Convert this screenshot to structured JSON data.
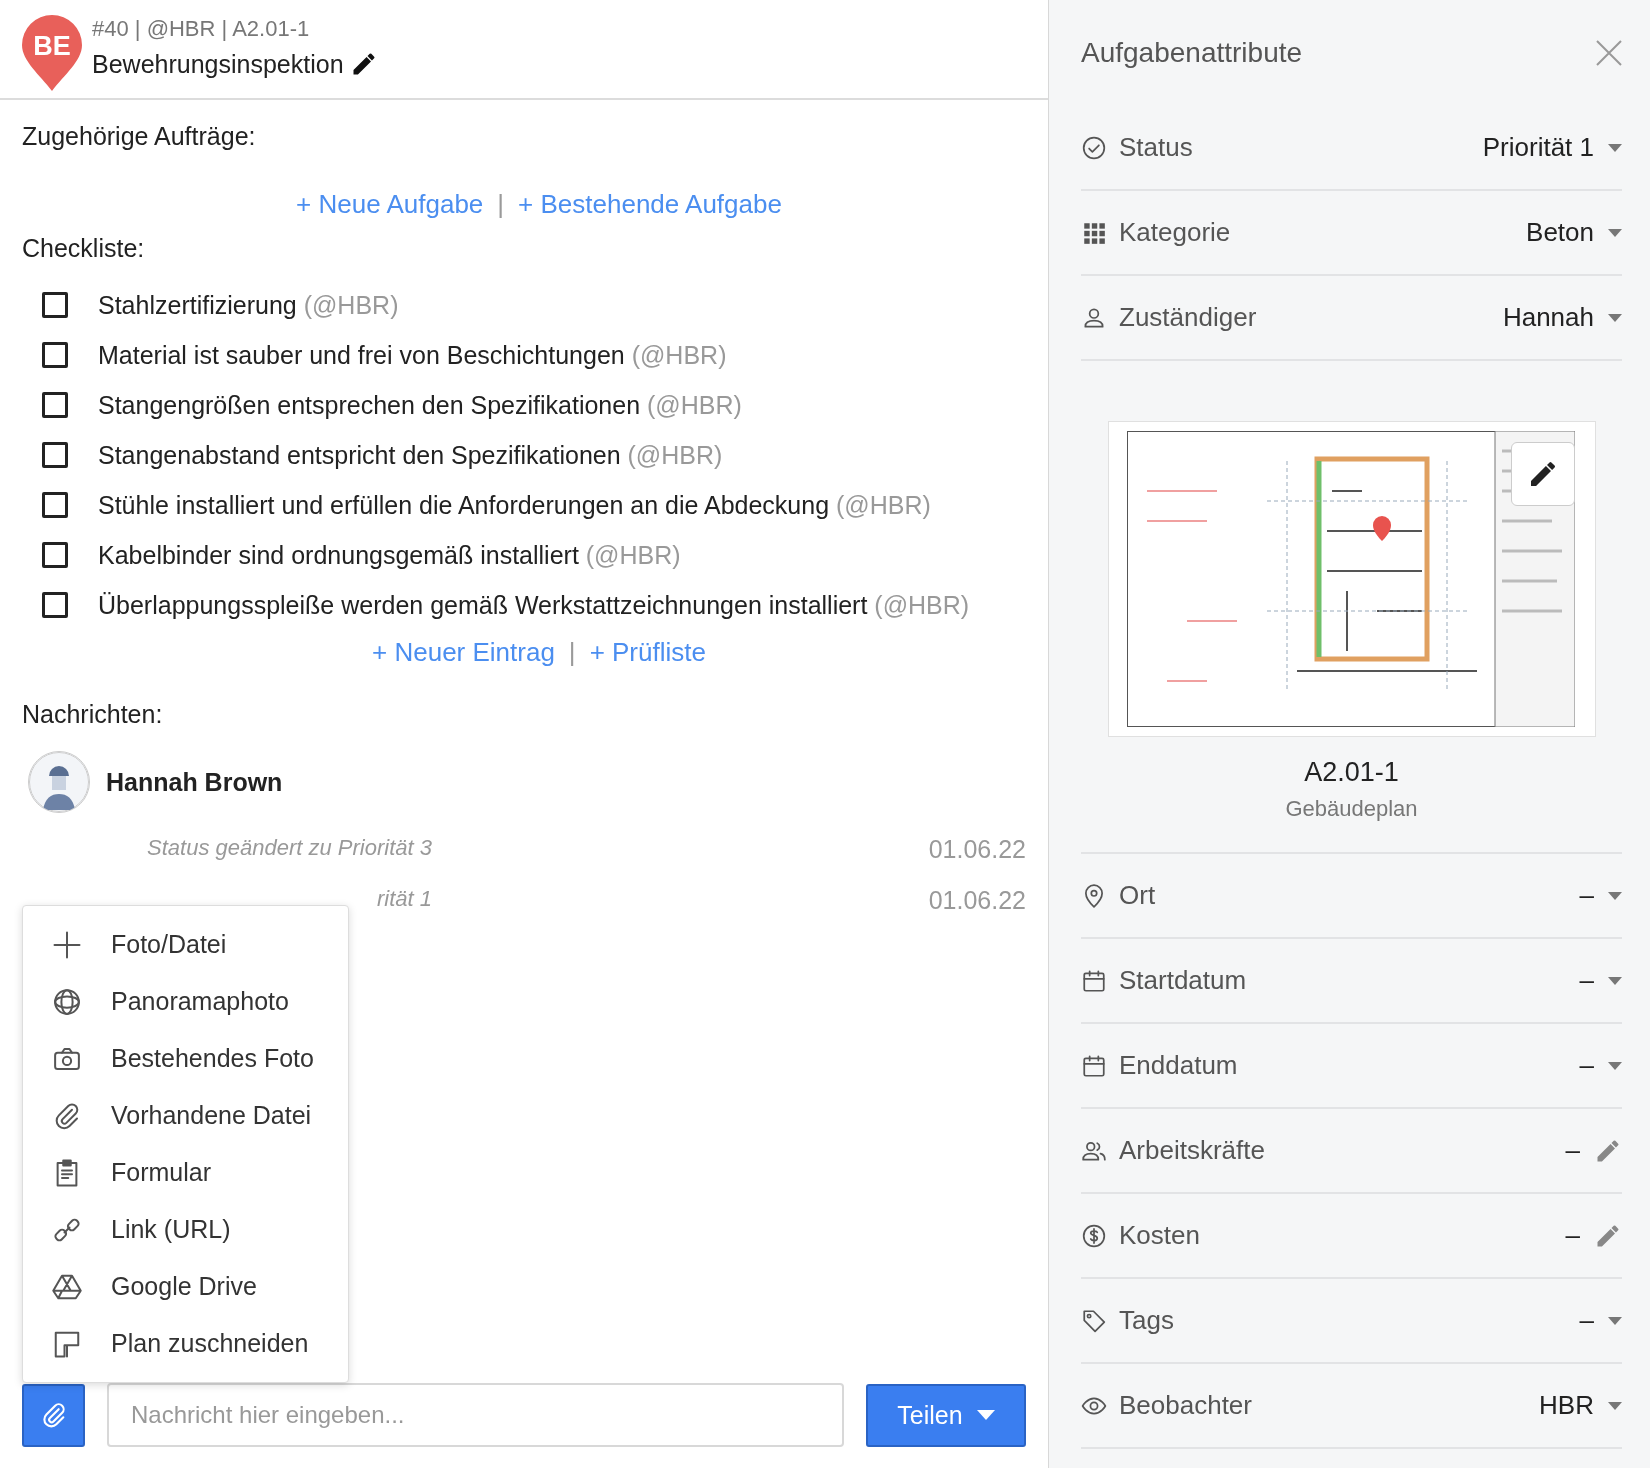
{
  "header": {
    "avatar": "BE",
    "meta": "#40 | @HBR | A2.01-1",
    "title": "Bewehrungsinspektion"
  },
  "related": {
    "heading": "Zugehörige Aufträge:",
    "actions": [
      "+ Neue Aufgabe",
      "+ Bestehende Aufgabe"
    ],
    "separator": "|"
  },
  "checklist": {
    "heading": "Checkliste:",
    "items": [
      {
        "text": "Stahlzertifizierung",
        "assignee": "(@HBR)",
        "checked": false
      },
      {
        "text": "Material ist sauber und frei von Beschichtungen",
        "assignee": "(@HBR)",
        "checked": false
      },
      {
        "text": "Stangengrößen entsprechen den Spezifikationen",
        "assignee": "(@HBR)",
        "checked": false
      },
      {
        "text": "Stangenabstand entspricht den Spezifikationen",
        "assignee": "(@HBR)",
        "checked": false
      },
      {
        "text": "Stühle installiert und erfüllen die Anforderungen an die Abdeckung",
        "assignee": "(@HBR)",
        "checked": false
      },
      {
        "text": "Kabelbinder sind ordnungsgemäß installiert",
        "assignee": "(@HBR)",
        "checked": false
      },
      {
        "text": "Überlappungsspleiße werden gemäß Werkstattzeichnungen installiert",
        "assignee": "(@HBR)",
        "checked": false
      }
    ],
    "actions": [
      "+ Neuer Eintrag",
      "+ Prüfliste"
    ],
    "separator": "|"
  },
  "messages": {
    "heading": "Nachrichten:",
    "author": "Hannah Brown",
    "entries": [
      {
        "text": "Status geändert zu Priorität 3",
        "date": "01.06.22"
      },
      {
        "text": "rität 1",
        "date": "01.06.22"
      }
    ]
  },
  "attach_menu": {
    "items": [
      {
        "kind": "plus",
        "label": "Foto/Datei"
      },
      {
        "kind": "globe",
        "label": "Panoramaphoto"
      },
      {
        "kind": "camera",
        "label": "Bestehendes Foto"
      },
      {
        "kind": "clip",
        "label": "Vorhandene Datei"
      },
      {
        "kind": "form",
        "label": "Formular"
      },
      {
        "kind": "link",
        "label": "Link (URL)"
      },
      {
        "kind": "drive",
        "label": "Google Drive"
      },
      {
        "kind": "crop",
        "label": "Plan zuschneiden"
      }
    ]
  },
  "composer": {
    "placeholder": "Nachricht hier eingeben...",
    "send": "Teilen"
  },
  "attributes": {
    "title": "Aufgabenattribute",
    "rows_top": [
      {
        "kind": "status",
        "label": "Status",
        "value": "Priorität 1",
        "control": {
          "kind": "dropdown"
        }
      },
      {
        "kind": "grid",
        "label": "Kategorie",
        "value": "Beton",
        "control": {
          "kind": "dropdown"
        }
      },
      {
        "kind": "person",
        "label": "Zuständiger",
        "value": "Hannah",
        "control": {
          "kind": "dropdown"
        }
      }
    ],
    "plan": {
      "code": "A2.01-1",
      "name": "Gebäudeplan"
    },
    "rows_bottom": [
      {
        "kind": "pin",
        "label": "Ort",
        "value": "–",
        "control": {
          "kind": "dropdown"
        }
      },
      {
        "kind": "calendar",
        "label": "Startdatum",
        "value": "–",
        "control": {
          "kind": "dropdown"
        }
      },
      {
        "kind": "calendar",
        "label": "Enddatum",
        "value": "–",
        "control": {
          "kind": "dropdown"
        }
      },
      {
        "kind": "people",
        "label": "Arbeitskräfte",
        "value": "–",
        "control": {
          "kind": "edit"
        }
      },
      {
        "kind": "dollar",
        "label": "Kosten",
        "value": "–",
        "control": {
          "kind": "edit"
        }
      },
      {
        "kind": "tag",
        "label": "Tags",
        "value": "–",
        "control": {
          "kind": "dropdown"
        }
      },
      {
        "kind": "eye",
        "label": "Beobachter",
        "value": "HBR",
        "control": {
          "kind": "dropdown"
        }
      }
    ]
  }
}
